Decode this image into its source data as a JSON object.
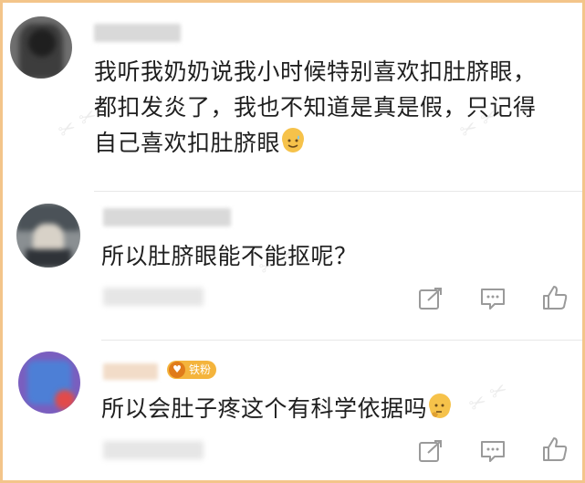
{
  "comments": [
    {
      "text_lines": [
        "我听我奶奶说我小时候特别喜欢扣肚脐眼，",
        "都扣发炎了，我也不知道是真是假，只记得",
        "自己喜欢扣肚脐眼"
      ],
      "emoji_icon": "sweat-smile-emoji"
    },
    {
      "text": "所以肚脐眼能不能抠呢？",
      "actions": [
        "share-icon",
        "comment-icon",
        "like-icon"
      ]
    },
    {
      "badge": "铁粉",
      "text": "所以会肚子疼这个有科学依据吗",
      "emoji_icon": "thinking-emoji",
      "actions": [
        "share-icon",
        "comment-icon",
        "like-icon"
      ]
    }
  ],
  "colors": {
    "frame_border": "#f3c58a",
    "badge_bg": "#f4b43c",
    "icon_gray": "#9a9a9a"
  }
}
